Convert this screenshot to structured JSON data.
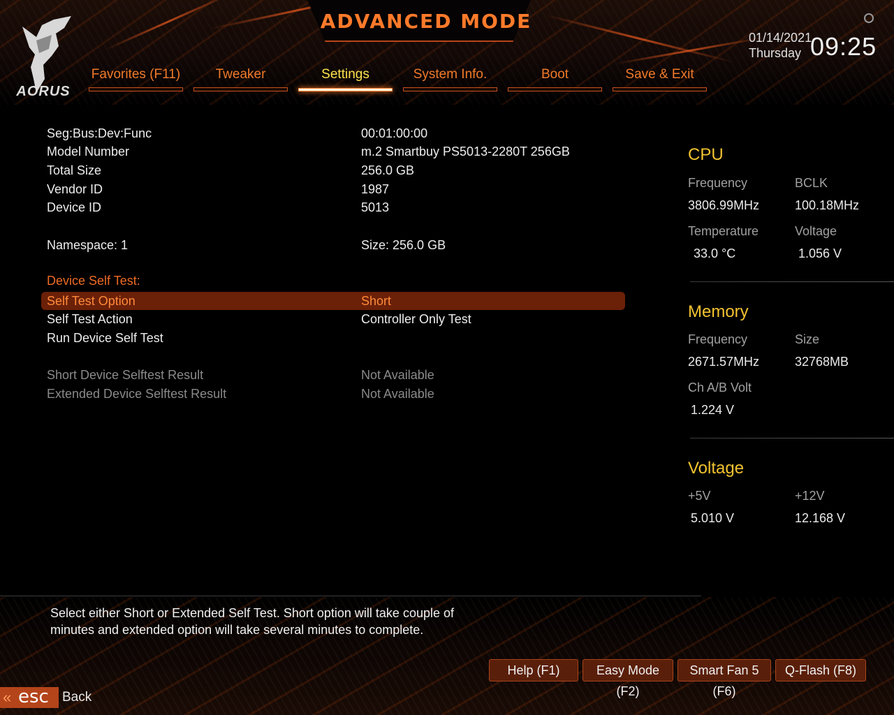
{
  "header": {
    "title": "ADVANCED MODE",
    "brand": "AORUS",
    "date": "01/14/2021",
    "day": "Thursday",
    "time": "09:25"
  },
  "tabs": [
    {
      "label": "Favorites (F11)",
      "active": false
    },
    {
      "label": "Tweaker",
      "active": false
    },
    {
      "label": "Settings",
      "active": true
    },
    {
      "label": "System Info.",
      "active": false
    },
    {
      "label": "Boot",
      "active": false
    },
    {
      "label": "Save & Exit",
      "active": false
    }
  ],
  "info": {
    "seg_label": "Seg:Bus:Dev:Func",
    "seg_value": "00:01:00:00",
    "model_label": "Model Number",
    "model_value": "m.2 Smartbuy PS5013-2280T 256GB",
    "size_label": "Total Size",
    "size_value": "256.0 GB",
    "vendor_label": "Vendor ID",
    "vendor_value": "1987",
    "device_label": "Device ID",
    "device_value": "5013",
    "namespace_label": "Namespace: 1",
    "namespace_value": "Size: 256.0 GB"
  },
  "self_test": {
    "heading": "Device Self Test:",
    "option_label": "Self Test Option",
    "option_value": "Short",
    "action_label": "Self Test Action",
    "action_value": "Controller Only Test",
    "run_label": "Run Device Self Test",
    "short_label": "Short Device Selftest Result",
    "short_value": "Not Available",
    "extended_label": "Extended Device Selftest Result",
    "extended_value": "Not Available"
  },
  "sidebar": {
    "cpu": {
      "title": "CPU",
      "freq_label": "Frequency",
      "freq_value": "3806.99MHz",
      "bclk_label": "BCLK",
      "bclk_value": "100.18MHz",
      "temp_label": "Temperature",
      "temp_value": "33.0 °C",
      "volt_label": "Voltage",
      "volt_value": "1.056 V"
    },
    "memory": {
      "title": "Memory",
      "freq_label": "Frequency",
      "freq_value": "2671.57MHz",
      "size_label": "Size",
      "size_value": "32768MB",
      "ab_label": "Ch A/B Volt",
      "ab_value": "1.224 V"
    },
    "voltage": {
      "title": "Voltage",
      "v5_label": "+5V",
      "v5_value": "5.010 V",
      "v12_label": "+12V",
      "v12_value": "12.168 V"
    }
  },
  "help": {
    "text": "Select either Short or Extended Self Test. Short option will take couple of minutes and extended option will take several minutes to complete."
  },
  "footer": {
    "help_btn": "Help (F1)",
    "easy_btn": "Easy Mode (F2)",
    "fan_btn": "Smart Fan 5 (F6)",
    "qflash_btn": "Q-Flash (F8)",
    "esc_label": "esc",
    "back_label": "Back"
  },
  "colors": {
    "accent": "#f07a2a",
    "active_tab": "#ffe34d",
    "side_title": "#f2c230",
    "selection": "#6b2008"
  }
}
